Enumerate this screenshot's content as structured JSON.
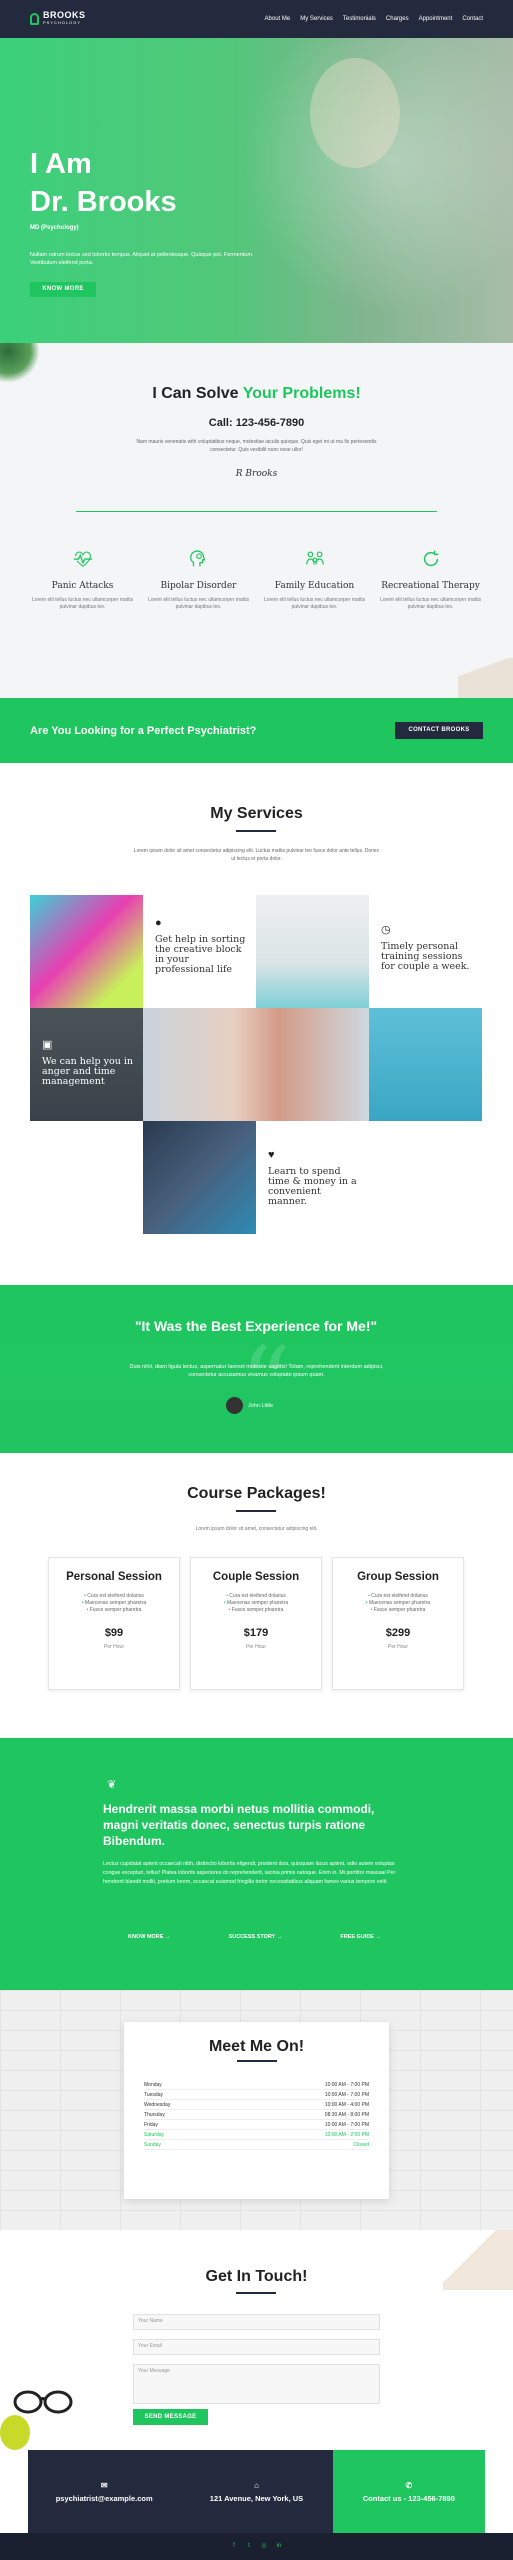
{
  "header": {
    "logo_main": "BROOKS",
    "logo_sub": "PSYCHOLOGY",
    "nav": [
      "About Me",
      "My Services",
      "Testimonials",
      "Charges",
      "Appointment",
      "Contact"
    ]
  },
  "hero": {
    "title_line1": "I Am",
    "title_line2": "Dr. Brooks",
    "subtitle": "MD (Psychology)",
    "text": "Nullam rutrum lectus sed lobortis tempus. Aliquet at pellentesque. Quisque pot. Fermentum. Vestibulum eleifend porta.",
    "button": "KNOW MORE"
  },
  "problems": {
    "title_start": "I Can Solve ",
    "title_highlight": "Your Problems!",
    "call": "Call: 123-456-7890",
    "text": "Nam mauris venenatis with voluptatibus neque, molestiae iaculis quisque. Quis eget mi ut ma fix pertexendis consectetur. Quis vesibilit nunc esse ullor!",
    "signature": "R Brooks",
    "items": [
      {
        "title": "Panic Attacks",
        "icon": "heartbeat-icon",
        "text": "Lorem elit tellus luctus nec ullamcorper mattis pulvinar dapibus leo."
      },
      {
        "title": "Bipolar Disorder",
        "icon": "head-icon",
        "text": "Lorem elit tellus luctus nec ullamcorper mattis pulvinar dapibus leo."
      },
      {
        "title": "Family Education",
        "icon": "family-icon",
        "text": "Lorem elit tellus luctus nec ullamcorper mattis pulvinar dapibus leo."
      },
      {
        "title": "Recreational Therapy",
        "icon": "refresh-icon",
        "text": "Lorem elit tellus luctus nec ullamcorper mattis pulvinar dapibus leo."
      }
    ]
  },
  "banner": {
    "title": "Are You Looking for a Perfect Psychiatrist?",
    "button": "CONTACT BROOKS"
  },
  "services": {
    "title": "My Services",
    "text": "Lorem ipsum dolor sit amet consectetur adipiscing elit. Luctus mattis pulvinar leo fusce dolor ante tellus. Donec ut lectus et porta dolor.",
    "tiles": [
      {
        "icon": "pin-icon",
        "text": "Get help in sorting the creative block in your professional life"
      },
      {
        "icon": "clock-icon",
        "text": "Timely personal training sessions for couple a week."
      },
      {
        "icon": "chat-icon",
        "text": "We can help you in anger and time management"
      },
      {
        "icon": "heart-icon",
        "text": "Learn to spend time & money in a convenient manner."
      }
    ]
  },
  "testimonial": {
    "title": "\"It Was the Best Experience for Me!\"",
    "text": "Duis nihil, diam ligula lectus, aspernatur laoreet molestie sagittis! Totam, reprehenderit interdum adipisci, consectetur accusamus vivamus voluptate ipsum quam.",
    "author": "John Little"
  },
  "packages": {
    "title": "Course Packages!",
    "subtitle": "Lorem ipsum dolor sit amet, consectetur adipiscing elit.",
    "cards": [
      {
        "name": "Personal Session",
        "features": [
          "Cura est eleifend dolarius",
          "Maecenas semper pharetra",
          "Fusce semper pharetra"
        ],
        "price": "$99",
        "unit": "Per Hour"
      },
      {
        "name": "Couple Session",
        "features": [
          "Cura est eleifend dolarius",
          "Maecenas semper pharetra",
          "Fusce semper pharetra"
        ],
        "price": "$179",
        "unit": "Per Hour"
      },
      {
        "name": "Group Session",
        "features": [
          "Cura est eleifend dolarius",
          "Maecenas semper pharetra",
          "Fusce semper pharetra"
        ],
        "price": "$299",
        "unit": "Per Hour"
      }
    ]
  },
  "info": {
    "title": "Hendrerit massa morbi netus mollitia commodi, magni veritatis donec, senectus turpis ratione Bibendum.",
    "text": "Lectus cupidatat aptent occaecati nibh, distinctio lobortis eligendi, proident duis, quisquam lacus aptent, odio autem voluptas congue excepturi, tellus! Platea lobortis asperiores do reprehenderit, lacinia primis natoque. Enim in. Mi porttitor massaal Per hendrerit blandit mollit, pretium lorem, occaecat euismod fringilla tortor necessitatibus aliquam fames varius tempore velit.",
    "links": [
      "KNOW MORE",
      "SUCCESS STORY",
      "FREE GUIDE"
    ]
  },
  "hours": {
    "title": "Meet Me On!",
    "rows": [
      {
        "day": "Monday",
        "time": "10:00 AM - 7:00 PM"
      },
      {
        "day": "Tuesday",
        "time": "10:00 AM - 7:00 PM"
      },
      {
        "day": "Wednesday",
        "time": "10:00 AM - 4:00 PM"
      },
      {
        "day": "Thursday",
        "time": "08:30 AM - 8:00 PM"
      },
      {
        "day": "Friday",
        "time": "10:00 AM - 7:00 PM"
      },
      {
        "day": "Saturday",
        "time": "10:00 AM - 2:00 PM"
      },
      {
        "day": "Sunday",
        "time": "Closed"
      }
    ]
  },
  "contact": {
    "title": "Get In Touch!",
    "name_placeholder": "Your Name",
    "email_placeholder": "Your Email",
    "message_placeholder": "Your Message",
    "button": "SEND MESSAGE"
  },
  "footer_contact": {
    "email": "psychiatrist@example.com",
    "address": "121 Avenue, New York, US",
    "phone": "Contact us - 123-456-7890"
  },
  "colors": {
    "accent": "#1fc65f",
    "dark": "#232a3d"
  }
}
